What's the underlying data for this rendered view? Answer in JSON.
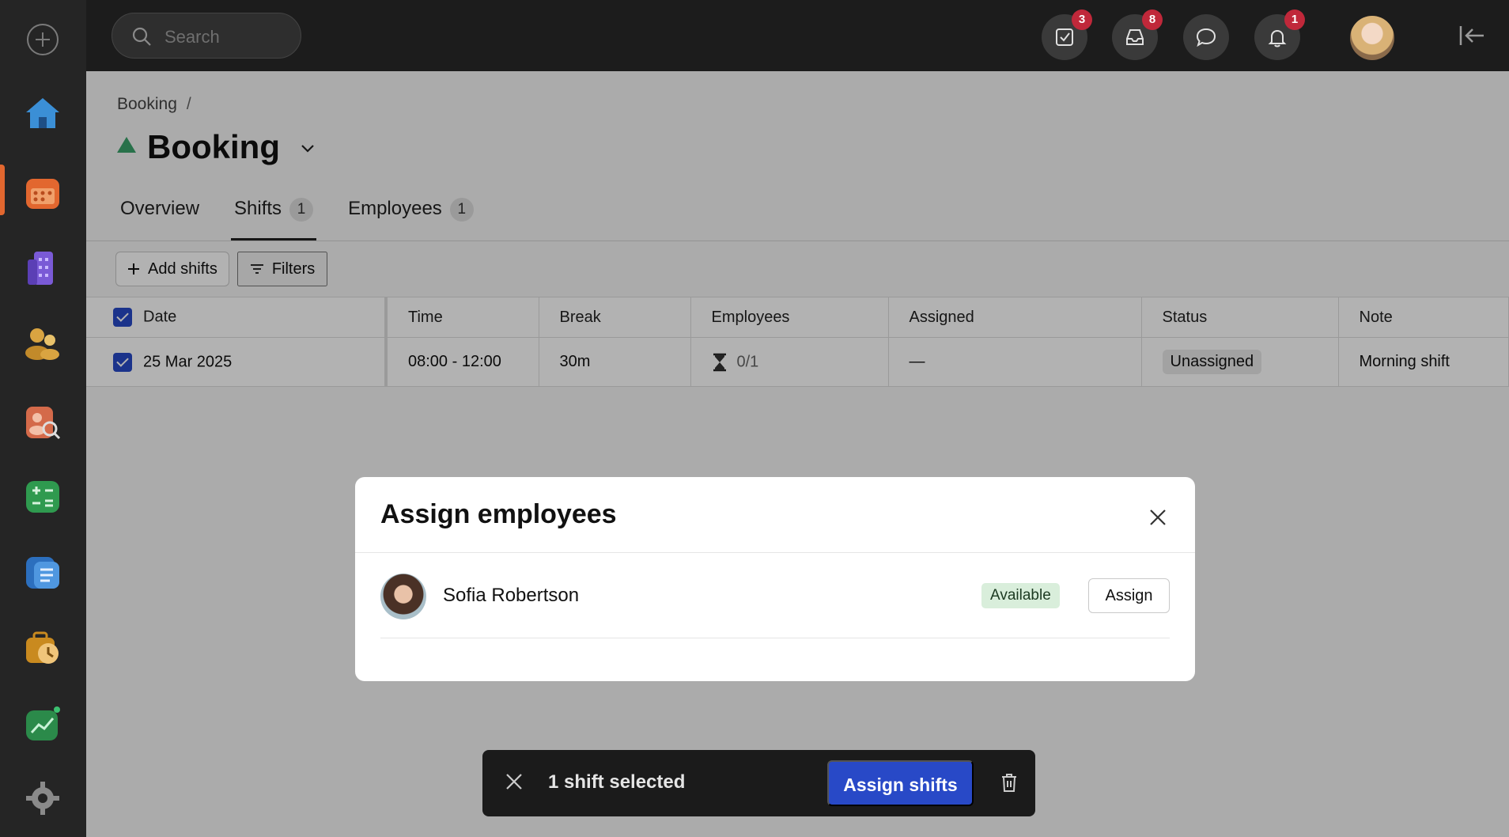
{
  "search": {
    "placeholder": "Search"
  },
  "topbar": {
    "tasks_badge": "3",
    "inbox_badge": "8",
    "notifications_badge": "1"
  },
  "breadcrumb": {
    "item": "Booking",
    "separator": "/"
  },
  "page": {
    "title": "Booking"
  },
  "tabs": [
    {
      "label": "Overview",
      "count": ""
    },
    {
      "label": "Shifts",
      "count": "1"
    },
    {
      "label": "Employees",
      "count": "1"
    }
  ],
  "toolbar": {
    "add_shifts": "Add shifts",
    "filters": "Filters"
  },
  "table": {
    "headers": [
      "Date",
      "Time",
      "Break",
      "Employees",
      "Assigned",
      "Status",
      "Note"
    ],
    "rows": [
      {
        "date": "25 Mar 2025",
        "time": "08:00 - 12:00",
        "break": "30m",
        "employees": "0/1",
        "assigned": "—",
        "status": "Unassigned",
        "note": "Morning shift"
      }
    ]
  },
  "modal": {
    "title": "Assign employees",
    "employees": [
      {
        "name": "Sofia Robertson",
        "availability": "Available",
        "action": "Assign"
      }
    ]
  },
  "selection_bar": {
    "text": "1 shift selected",
    "assign_label": "Assign shifts"
  },
  "colors": {
    "accent": "#2849c7",
    "badge": "#c0283a",
    "available_bg": "#d9eedb",
    "active_nav": "#e2672f"
  }
}
